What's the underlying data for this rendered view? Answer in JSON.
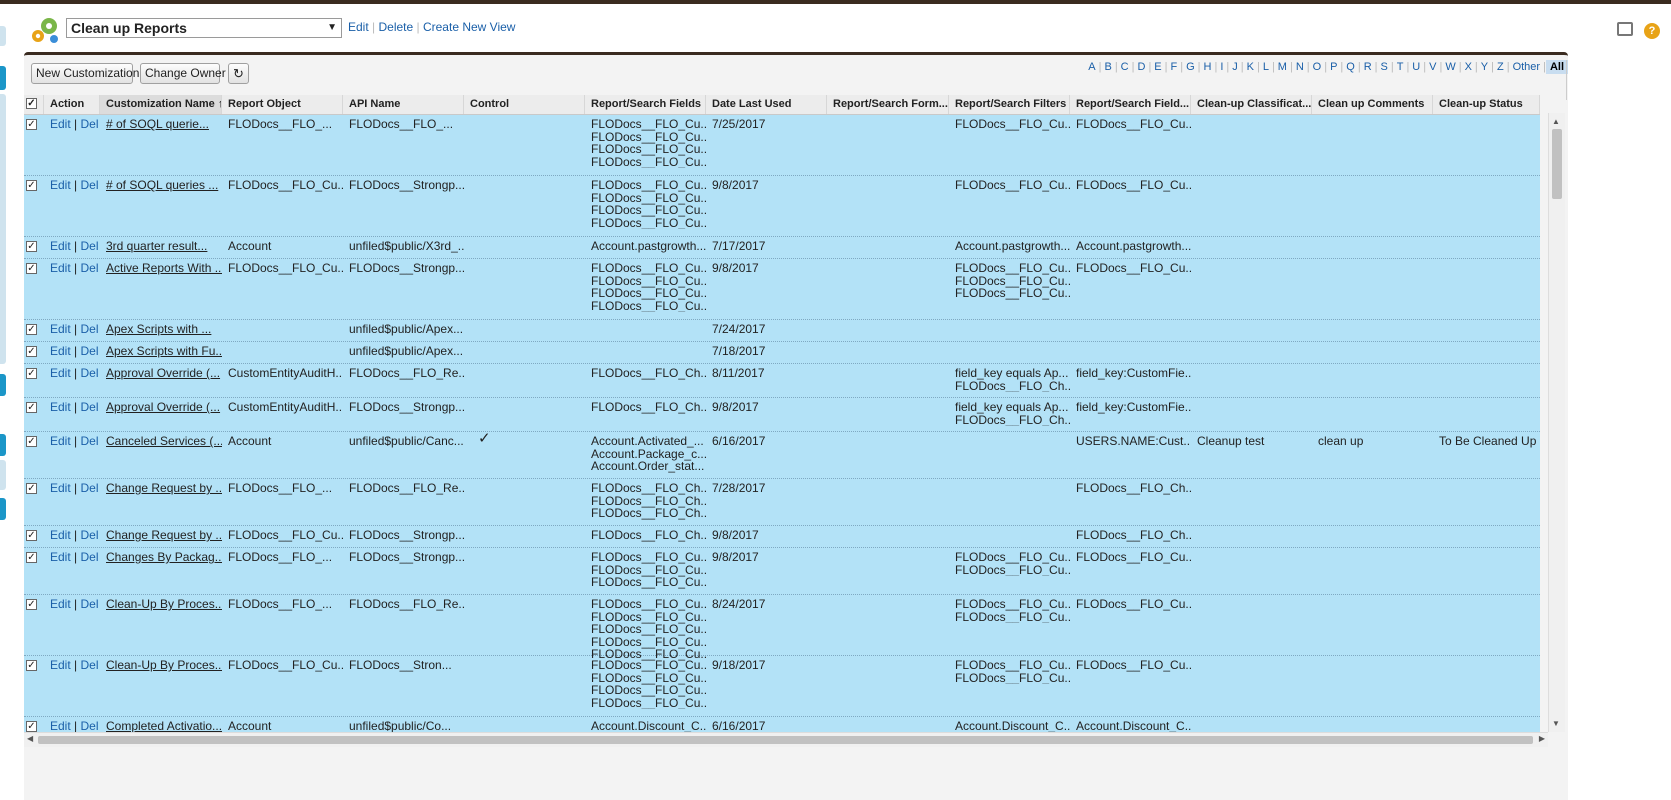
{
  "view": {
    "selected": "Clean up Reports",
    "edit": "Edit",
    "delete": "Delete",
    "create": "Create New View"
  },
  "toolbar": {
    "new_customization": "New Customization",
    "change_owner": "Change Owner"
  },
  "alpha": [
    "A",
    "B",
    "C",
    "D",
    "E",
    "F",
    "G",
    "H",
    "I",
    "J",
    "K",
    "L",
    "M",
    "N",
    "O",
    "P",
    "Q",
    "R",
    "S",
    "T",
    "U",
    "V",
    "W",
    "X",
    "Y",
    "Z",
    "Other",
    "All"
  ],
  "columns": {
    "action": "Action",
    "name": "Customization Name",
    "object": "Report Object",
    "api": "API Name",
    "control": "Control",
    "fields": "Report/Search Fields",
    "date": "Date Last Used",
    "formula": "Report/Search Form...",
    "filters": "Report/Search Filters",
    "field2": "Report/Search Field...",
    "class": "Clean-up Classificat...",
    "comments": "Clean up Comments",
    "status": "Clean-up Status"
  },
  "action_edit": "Edit",
  "action_del": "Del",
  "check_mark": "✓",
  "rows": [
    {
      "name": "# of SOQL querie...",
      "object": "FLODocs__FLO_...",
      "api": "FLODocs__FLO_...",
      "control": "",
      "fields": [
        "FLODocs__FLO_Cu...",
        "FLODocs__FLO_Cu...",
        "FLODocs__FLO_Cu...",
        "FLODocs__FLO_Cu..."
      ],
      "date": "7/25/2017",
      "filters": [
        "FLODocs__FLO_Cu..."
      ],
      "field2": [
        "FLODocs__FLO_Cu..."
      ],
      "class": "",
      "comments": "",
      "status": ""
    },
    {
      "name": "# of SOQL queries ...",
      "object": "FLODocs__FLO_Cu...",
      "api": "FLODocs__Strongp...",
      "control": "",
      "fields": [
        "FLODocs__FLO_Cu...",
        "FLODocs__FLO_Cu...",
        "FLODocs__FLO_Cu...",
        "FLODocs__FLO_Cu..."
      ],
      "date": "9/8/2017",
      "filters": [
        "FLODocs__FLO_Cu..."
      ],
      "field2": [
        "FLODocs__FLO_Cu..."
      ],
      "class": "",
      "comments": "",
      "status": ""
    },
    {
      "name": "3rd quarter result...",
      "object": "Account",
      "api": "unfiled$public/X3rd_...",
      "control": "",
      "fields": [
        "Account.pastgrowth..."
      ],
      "date": "7/17/2017",
      "filters": [
        "Account.pastgrowth..."
      ],
      "field2": [
        "Account.pastgrowth..."
      ],
      "class": "",
      "comments": "",
      "status": ""
    },
    {
      "name": "Active Reports With ...",
      "object": "FLODocs__FLO_Cu...",
      "api": "FLODocs__Strongp...",
      "control": "",
      "fields": [
        "FLODocs__FLO_Cu...",
        "FLODocs__FLO_Cu...",
        "FLODocs__FLO_Cu...",
        "FLODocs__FLO_Cu..."
      ],
      "date": "9/8/2017",
      "filters": [
        "FLODocs__FLO_Cu...",
        "FLODocs__FLO_Cu...",
        "FLODocs__FLO_Cu..."
      ],
      "field2": [
        "FLODocs__FLO_Cu..."
      ],
      "class": "",
      "comments": "",
      "status": ""
    },
    {
      "name": "Apex Scripts with ...",
      "object": "",
      "api": "unfiled$public/Apex...",
      "control": "",
      "fields": [],
      "date": "7/24/2017",
      "filters": [],
      "field2": [],
      "class": "",
      "comments": "",
      "status": ""
    },
    {
      "name": "Apex Scripts with Fu...",
      "object": "",
      "api": "unfiled$public/Apex...",
      "control": "",
      "fields": [],
      "date": "7/18/2017",
      "filters": [],
      "field2": [],
      "class": "",
      "comments": "",
      "status": ""
    },
    {
      "name": "Approval Override (...",
      "object": "CustomEntityAuditH...",
      "api": "FLODocs__FLO_Re...",
      "control": "",
      "fields": [
        "FLODocs__FLO_Ch..."
      ],
      "date": "8/11/2017",
      "filters": [
        "field_key equals Ap...",
        "FLODocs__FLO_Ch..."
      ],
      "field2": [
        "field_key:CustomFie..."
      ],
      "class": "",
      "comments": "",
      "status": ""
    },
    {
      "name": "Approval Override (...",
      "object": "CustomEntityAuditH...",
      "api": "FLODocs__Strongp...",
      "control": "",
      "fields": [
        "FLODocs__FLO_Ch..."
      ],
      "date": "9/8/2017",
      "filters": [
        "field_key equals Ap...",
        "FLODocs__FLO_Ch..."
      ],
      "field2": [
        "field_key:CustomFie..."
      ],
      "class": "",
      "comments": "",
      "status": ""
    },
    {
      "name": "Canceled Services (...",
      "object": "Account",
      "api": "unfiled$public/Canc...",
      "control": "check",
      "fields": [
        "Account.Activated_...",
        "Account.Package_c...",
        "Account.Order_stat..."
      ],
      "date": "6/16/2017",
      "filters": [],
      "field2": [
        "USERS.NAME:Cust..."
      ],
      "class": "Cleanup test",
      "comments": "clean up",
      "status": "To Be Cleaned Up"
    },
    {
      "name": "Change Request by ...",
      "object": "FLODocs__FLO_...",
      "api": "FLODocs__FLO_Re...",
      "control": "",
      "fields": [
        "FLODocs__FLO_Ch...",
        "FLODocs__FLO_Ch...",
        "FLODocs__FLO_Ch..."
      ],
      "date": "7/28/2017",
      "filters": [],
      "field2": [
        "FLODocs__FLO_Ch..."
      ],
      "class": "",
      "comments": "",
      "status": ""
    },
    {
      "name": "Change Request by ...",
      "object": "FLODocs__FLO_Cu...",
      "api": "FLODocs__Strongp...",
      "control": "",
      "fields": [
        "FLODocs__FLO_Ch..."
      ],
      "date": "9/8/2017",
      "filters": [],
      "field2": [
        "FLODocs__FLO_Ch..."
      ],
      "class": "",
      "comments": "",
      "status": ""
    },
    {
      "name": "Changes By Packag...",
      "object": "FLODocs__FLO_...",
      "api": "FLODocs__Strongp...",
      "control": "",
      "fields": [
        "FLODocs__FLO_Cu...",
        "FLODocs__FLO_Cu...",
        "FLODocs__FLO_Cu..."
      ],
      "date": "9/8/2017",
      "filters": [
        "FLODocs__FLO_Cu...",
        "FLODocs__FLO_Cu..."
      ],
      "field2": [
        "FLODocs__FLO_Cu..."
      ],
      "class": "",
      "comments": "",
      "status": ""
    },
    {
      "name": "Clean-Up By Proces...",
      "object": "FLODocs__FLO_...",
      "api": "FLODocs__FLO_Re...",
      "control": "",
      "fields": [
        "FLODocs__FLO_Cu...",
        "FLODocs__FLO_Cu...",
        "FLODocs__FLO_Cu...",
        "FLODocs__FLO_Cu...",
        "FLODocs__FLO_Cu..."
      ],
      "date": "8/24/2017",
      "filters": [
        "FLODocs__FLO_Cu...",
        "FLODocs__FLO_Cu..."
      ],
      "field2": [
        "FLODocs__FLO_Cu..."
      ],
      "class": "",
      "comments": "",
      "status": ""
    },
    {
      "name": "Clean-Up By Proces...",
      "object": "FLODocs__FLO_Cu...",
      "api": "FLODocs__Stron...",
      "control": "",
      "fields": [
        "FLODocs__FLO_Cu...",
        "FLODocs__FLO_Cu...",
        "FLODocs__FLO_Cu...",
        "FLODocs__FLO_Cu..."
      ],
      "date": "9/18/2017",
      "filters": [
        "FLODocs__FLO_Cu...",
        "FLODocs__FLO_Cu..."
      ],
      "field2": [
        "FLODocs__FLO_Cu..."
      ],
      "class": "",
      "comments": "",
      "status": ""
    },
    {
      "name": "Completed Activatio...",
      "object": "Account",
      "api": "unfiled$public/Co...",
      "control": "",
      "fields": [
        "Account.Discount_C..."
      ],
      "date": "6/16/2017",
      "filters": [
        "Account.Discount_C..."
      ],
      "field2": [
        "Account.Discount_C..."
      ],
      "class": "",
      "comments": "",
      "status": ""
    }
  ]
}
